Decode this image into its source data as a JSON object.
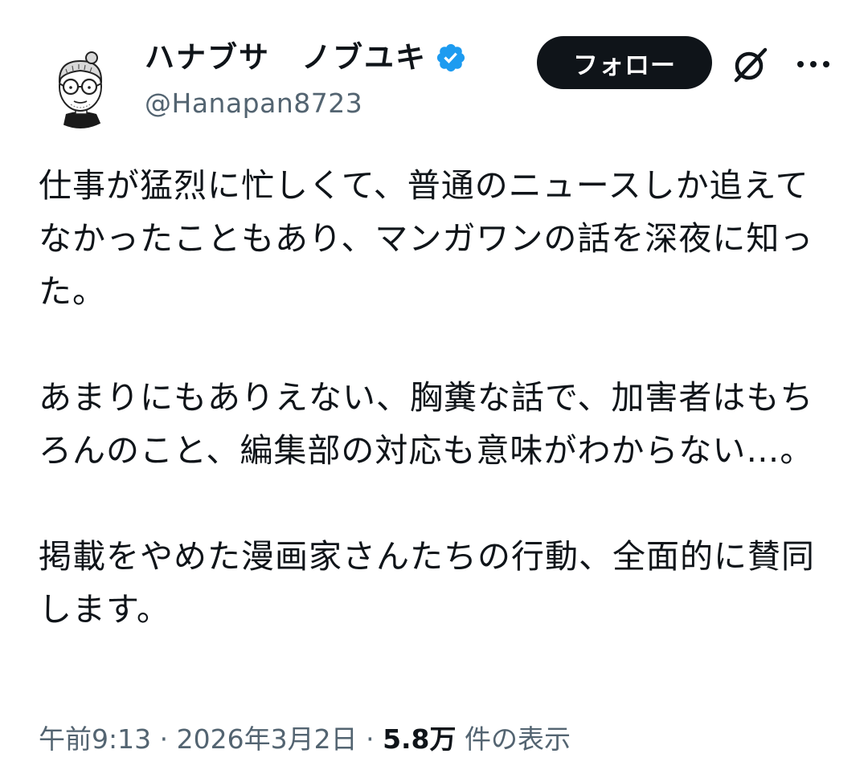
{
  "author": {
    "display_name": "ハナブサ　ノブユキ",
    "handle": "@Hanapan8723",
    "verified": true,
    "avatar_icon": "avatar-illustration-icon"
  },
  "actions": {
    "follow_label": "フォロー",
    "grok_icon": "grok-icon",
    "more_icon": "more-icon"
  },
  "tweet": {
    "paragraphs": [
      "仕事が猛烈に忙しくて、普通のニュースしか追えてなかったこともあり、マンガワンの話を深夜に知った。",
      "あまりにもありえない、胸糞な話で、加害者はもちろんのこと、編集部の対応も意味がわからない…。",
      "掲載をやめた漫画家さんたちの行動、全面的に賛同します。"
    ]
  },
  "meta": {
    "time": "午前9:13",
    "separator": " · ",
    "date": "2026年3月2日",
    "views_count": "5.8万",
    "views_label": " 件の表示"
  },
  "colors": {
    "text": "#0f1419",
    "secondary": "#536471",
    "verified_blue": "#1d9bf0",
    "button_bg": "#0f1419"
  }
}
